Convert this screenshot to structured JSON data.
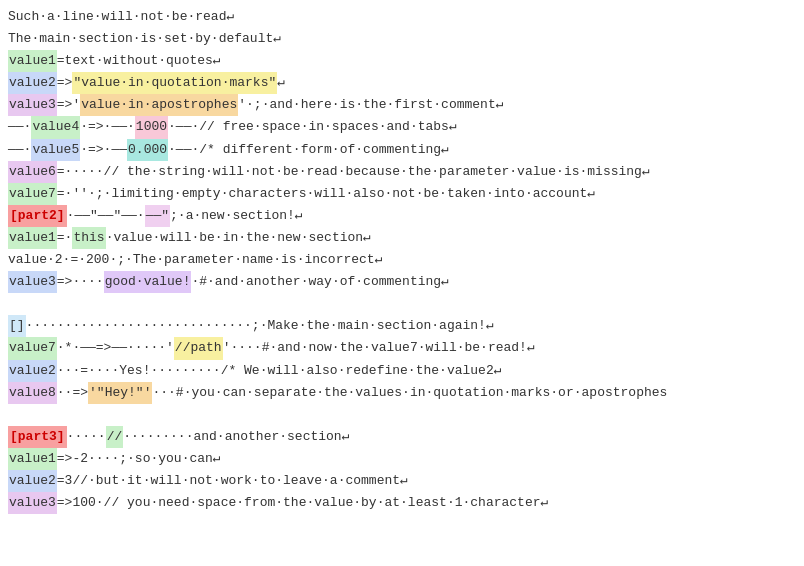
{
  "lines": [
    {
      "id": "l1",
      "content": "plain",
      "text": "Such·a·line·will·not·be·read↵"
    },
    {
      "id": "l2",
      "content": "plain",
      "text": "The·main·section·is·set·by·default↵"
    },
    {
      "id": "l3",
      "content": "mixed",
      "parts": [
        {
          "cls": "key-green",
          "text": "value1"
        },
        {
          "cls": "plain",
          "text": "=text·without·quotes↵"
        }
      ]
    },
    {
      "id": "l4",
      "content": "mixed",
      "parts": [
        {
          "cls": "key-blue",
          "text": "value2"
        },
        {
          "cls": "plain",
          "text": "=>"
        },
        {
          "cls": "val-yellow",
          "text": "\"value·in·quotation·marks\""
        },
        {
          "cls": "plain",
          "text": "↵"
        }
      ]
    },
    {
      "id": "l5",
      "content": "mixed",
      "parts": [
        {
          "cls": "key-purple",
          "text": "value3"
        },
        {
          "cls": "plain",
          "text": "=>'"
        },
        {
          "cls": "val-orange",
          "text": "value·in·apostrophes"
        },
        {
          "cls": "plain",
          "text": "'"
        },
        {
          "cls": "plain",
          "text": "·;·and·here·is·the·first·comment↵"
        }
      ]
    },
    {
      "id": "l6",
      "content": "mixed",
      "parts": [
        {
          "cls": "plain",
          "text": "――·"
        },
        {
          "cls": "key-green",
          "text": "value4"
        },
        {
          "cls": "plain",
          "text": "·=>·――·"
        },
        {
          "cls": "val-pink",
          "text": "1000"
        },
        {
          "cls": "plain",
          "text": "·――·// free·space·in·spaces·and·tabs↵"
        }
      ]
    },
    {
      "id": "l7",
      "content": "mixed",
      "parts": [
        {
          "cls": "plain",
          "text": "――·"
        },
        {
          "cls": "key-blue",
          "text": "value5"
        },
        {
          "cls": "plain",
          "text": "·=>·――"
        },
        {
          "cls": "val-teal",
          "text": "0.000"
        },
        {
          "cls": "plain",
          "text": "·――·/* different·form·of·commenting↵"
        }
      ]
    },
    {
      "id": "l8",
      "content": "mixed",
      "parts": [
        {
          "cls": "key-purple",
          "text": "value6"
        },
        {
          "cls": "plain",
          "text": "=·····// the·string·will·not·be·read·because·the·parameter·value·is·missing↵"
        }
      ]
    },
    {
      "id": "l9",
      "content": "mixed",
      "parts": [
        {
          "cls": "key-green",
          "text": "value7"
        },
        {
          "cls": "plain",
          "text": "=·''·;·limiting·empty·characters·will·also·not·be·taken·into·account↵"
        }
      ]
    },
    {
      "id": "l10",
      "content": "mixed",
      "parts": [
        {
          "cls": "section-header",
          "text": "[part2]"
        },
        {
          "cls": "plain",
          "text": "·――\"――\"――·"
        },
        {
          "cls": "section-misc",
          "text": "――\""
        },
        {
          "cls": "plain",
          "text": ";·a·new·section!↵"
        }
      ]
    },
    {
      "id": "l11",
      "content": "mixed",
      "parts": [
        {
          "cls": "key-green",
          "text": "value1"
        },
        {
          "cls": "plain",
          "text": "=·"
        },
        {
          "cls": "val-green",
          "text": "this"
        },
        {
          "cls": "plain",
          "text": "·value·will·be·in·the·new·section↵"
        }
      ]
    },
    {
      "id": "l12",
      "content": "mixed",
      "parts": [
        {
          "cls": "plain",
          "text": "value·2·=·200·;·"
        },
        {
          "cls": "plain",
          "text": "The"
        },
        {
          "cls": "plain",
          "text": "·parameter·name·is·incorrect↵"
        }
      ]
    },
    {
      "id": "l13",
      "content": "mixed",
      "parts": [
        {
          "cls": "key-blue",
          "text": "value3"
        },
        {
          "cls": "plain",
          "text": "=>····"
        },
        {
          "cls": "val-purple",
          "text": "good·value!"
        },
        {
          "cls": "plain",
          "text": "·#·and·another·way·of·commenting↵"
        }
      ]
    },
    {
      "id": "l14",
      "content": "blank"
    },
    {
      "id": "l15",
      "content": "mixed",
      "parts": [
        {
          "cls": "empty-section",
          "text": "[]"
        },
        {
          "cls": "plain",
          "text": "·····························;·Make·the·main·section·again!↵"
        }
      ]
    },
    {
      "id": "l16",
      "content": "mixed",
      "parts": [
        {
          "cls": "key-green",
          "text": "value7"
        },
        {
          "cls": "plain",
          "text": "·*·――=>――·····'"
        },
        {
          "cls": "val-yellow",
          "text": "//path"
        },
        {
          "cls": "plain",
          "text": "'····#·and·now·the·value7·will·be·read!↵"
        }
      ]
    },
    {
      "id": "l17",
      "content": "mixed",
      "parts": [
        {
          "cls": "key-blue",
          "text": "value2"
        },
        {
          "cls": "plain",
          "text": "···=····Yes!·········/* We·will·also·redefine·the·value2↵"
        }
      ]
    },
    {
      "id": "l18",
      "content": "mixed",
      "parts": [
        {
          "cls": "key-purple",
          "text": "value8"
        },
        {
          "cls": "plain",
          "text": "··=>"
        },
        {
          "cls": "val-orange",
          "text": "'\"Hey!\"'"
        },
        {
          "cls": "plain",
          "text": "···#·you·can·separate·the·values·in·quotation·marks·or·apostrophes"
        }
      ]
    },
    {
      "id": "l19",
      "content": "blank"
    },
    {
      "id": "l20",
      "content": "mixed",
      "parts": [
        {
          "cls": "section-header",
          "text": "[part3]"
        },
        {
          "cls": "plain",
          "text": "·····"
        },
        {
          "cls": "val-green",
          "text": "//"
        },
        {
          "cls": "plain",
          "text": "·········"
        },
        {
          "cls": "plain",
          "text": "and"
        },
        {
          "cls": "plain",
          "text": "·another·section↵"
        }
      ]
    },
    {
      "id": "l21",
      "content": "mixed",
      "parts": [
        {
          "cls": "key-green",
          "text": "value1"
        },
        {
          "cls": "plain",
          "text": "=>-2····;·so·you·can↵"
        }
      ]
    },
    {
      "id": "l22",
      "content": "mixed",
      "parts": [
        {
          "cls": "key-blue",
          "text": "value2"
        },
        {
          "cls": "plain",
          "text": "=3//·but·it·will·not·work·to·leave·a·comment↵"
        }
      ]
    },
    {
      "id": "l23",
      "content": "mixed",
      "parts": [
        {
          "cls": "key-purple",
          "text": "value3"
        },
        {
          "cls": "plain",
          "text": "=>100·// you·need·space·from·the·value·by·at·least·1·character↵"
        }
      ]
    }
  ]
}
